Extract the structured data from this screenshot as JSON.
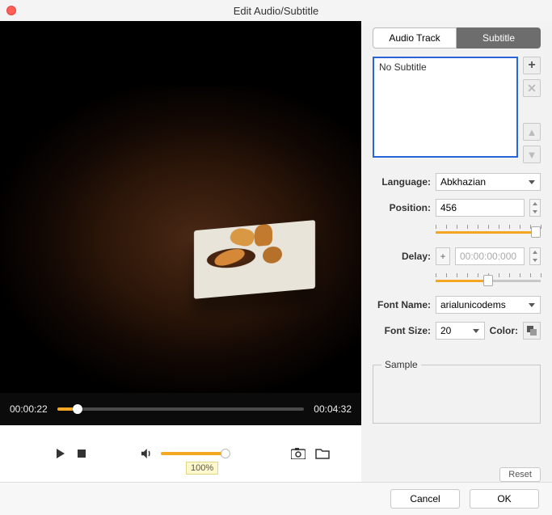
{
  "window": {
    "title": "Edit Audio/Subtitle"
  },
  "tabs": {
    "audio": "Audio Track",
    "subtitle": "Subtitle"
  },
  "subtitle_list": {
    "empty": "No Subtitle"
  },
  "labels": {
    "language": "Language:",
    "position": "Position:",
    "delay": "Delay:",
    "font_name": "Font Name:",
    "font_size": "Font Size:",
    "color": "Color:",
    "sample": "Sample"
  },
  "values": {
    "language": "Abkhazian",
    "position": "456",
    "delay": "00:00:00:000",
    "delay_sign": "+",
    "font_name": "arialunicodems",
    "font_size": "20"
  },
  "player": {
    "current": "00:00:22",
    "duration": "00:04:32",
    "volume_pct": "100%"
  },
  "buttons": {
    "reset": "Reset",
    "cancel": "Cancel",
    "ok": "OK"
  }
}
